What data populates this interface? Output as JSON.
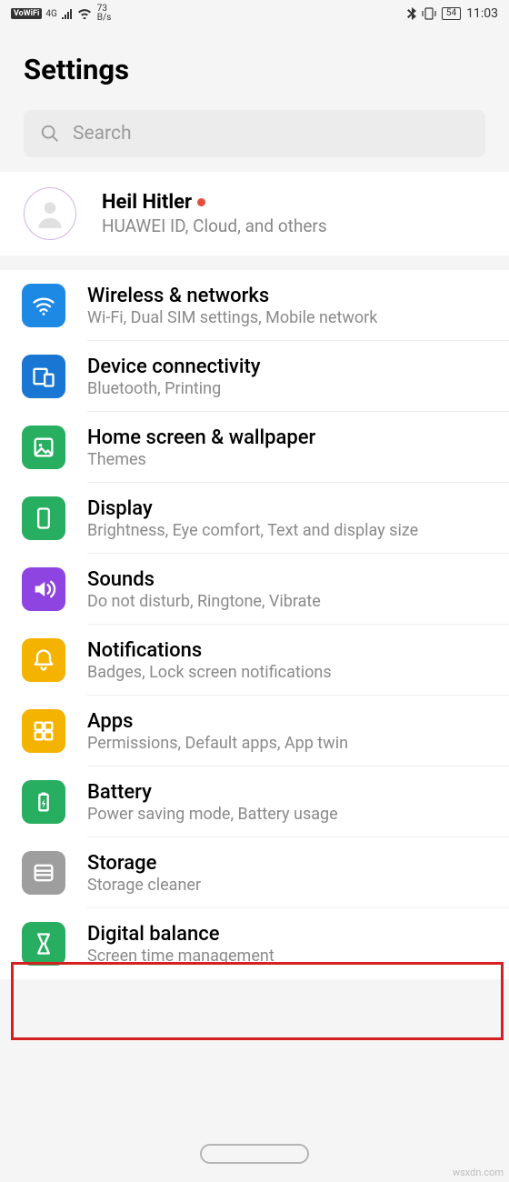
{
  "status_bar": {
    "vowifi": "VoWiFi",
    "net_type": "4G",
    "speed_value": "73",
    "speed_unit": "B/s",
    "battery": "54",
    "time": "11:03"
  },
  "header": {
    "title": "Settings"
  },
  "search": {
    "placeholder": "Search"
  },
  "account": {
    "name": "Heil Hitler",
    "subtitle": "HUAWEI ID, Cloud, and others"
  },
  "items": [
    {
      "icon": "wifi",
      "color": "#1e88e5",
      "title": "Wireless & networks",
      "sub": "Wi-Fi, Dual SIM settings, Mobile network"
    },
    {
      "icon": "connect",
      "color": "#1976d2",
      "title": "Device connectivity",
      "sub": "Bluetooth, Printing"
    },
    {
      "icon": "image",
      "color": "#27ae60",
      "title": "Home screen & wallpaper",
      "sub": "Themes"
    },
    {
      "icon": "phone",
      "color": "#27ae60",
      "title": "Display",
      "sub": "Brightness, Eye comfort, Text and display size"
    },
    {
      "icon": "sound",
      "color": "#8e44e0",
      "title": "Sounds",
      "sub": "Do not disturb, Ringtone, Vibrate"
    },
    {
      "icon": "bell",
      "color": "#f5b301",
      "title": "Notifications",
      "sub": "Badges, Lock screen notifications"
    },
    {
      "icon": "apps",
      "color": "#f5b301",
      "title": "Apps",
      "sub": "Permissions, Default apps, App twin",
      "highlighted": true
    },
    {
      "icon": "battery",
      "color": "#27ae60",
      "title": "Battery",
      "sub": "Power saving mode, Battery usage"
    },
    {
      "icon": "storage",
      "color": "#9e9e9e",
      "title": "Storage",
      "sub": "Storage cleaner"
    },
    {
      "icon": "balance",
      "color": "#27ae60",
      "title": "Digital balance",
      "sub": "Screen time management"
    }
  ],
  "watermark": "wsxdn.com"
}
